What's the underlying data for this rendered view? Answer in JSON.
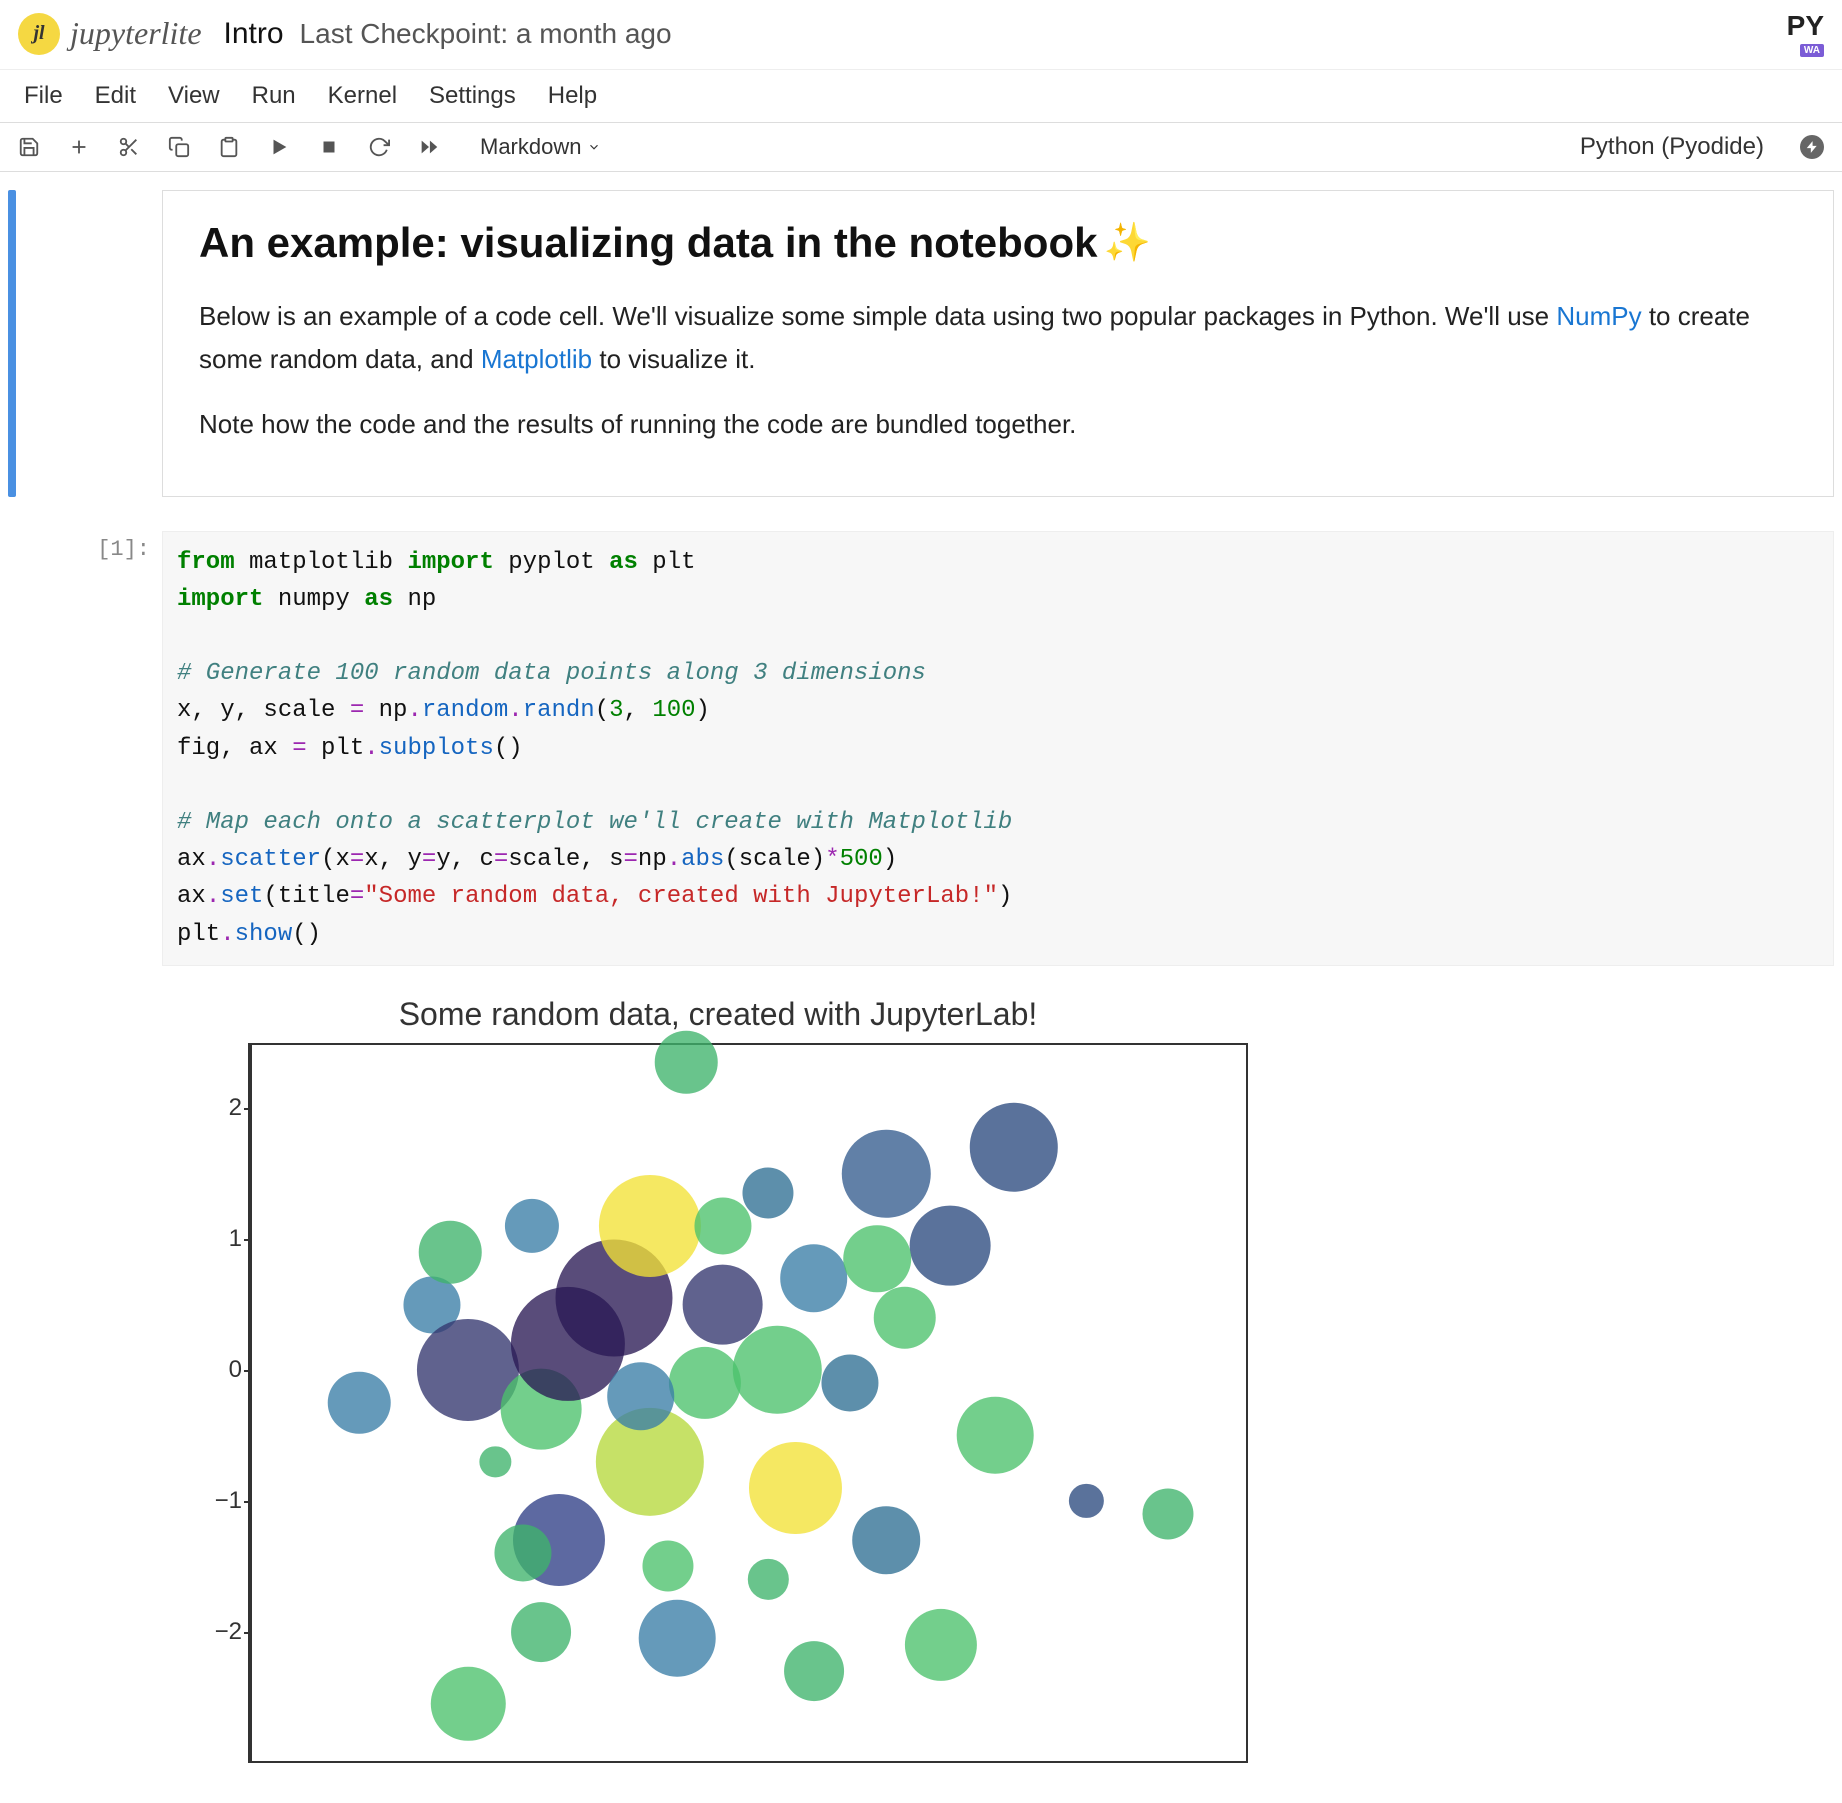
{
  "header": {
    "logo_initials": "jl",
    "logo_text": "jupyterlite",
    "doc_title": "Intro",
    "checkpoint": "Last Checkpoint: a month ago",
    "py_label": "PY",
    "wa_label": "WA"
  },
  "menubar": [
    "File",
    "Edit",
    "View",
    "Run",
    "Kernel",
    "Settings",
    "Help"
  ],
  "toolbar": {
    "celltype": "Markdown",
    "kernel": "Python (Pyodide)"
  },
  "md_cell": {
    "heading": "An example: visualizing data in the notebook",
    "sparkle": "✨",
    "para1_pre": "Below is an example of a code cell. We'll visualize some simple data using two popular packages in Python. We'll use ",
    "numpy": "NumPy",
    "para1_mid": " to create some random data, and ",
    "matplotlib": "Matplotlib",
    "para1_post": " to visualize it.",
    "para2": "Note how the code and the results of running the code are bundled together."
  },
  "code_cell": {
    "prompt": "[1]:",
    "l1_from": "from",
    "l1_mpl": " matplotlib ",
    "l1_import": "import",
    "l1_rest": " pyplot ",
    "l1_as": "as",
    "l1_plt": " plt",
    "l2_import": "import",
    "l2_np": " numpy ",
    "l2_as": "as",
    "l2_rest": " np",
    "l4_cmt": "# Generate 100 random data points along 3 dimensions",
    "l5_a": "x, y, scale ",
    "l5_eq": "=",
    "l5_b": " np",
    "l5_dot1": ".",
    "l5_rand": "random",
    "l5_dot2": ".",
    "l5_randn": "randn",
    "l5_p": "(",
    "l5_n1": "3",
    "l5_c": ", ",
    "l5_n2": "100",
    "l5_cp": ")",
    "l6_a": "fig, ax ",
    "l6_eq": "=",
    "l6_b": " plt",
    "l6_dot": ".",
    "l6_fn": "subplots",
    "l6_p": "()",
    "l8_cmt": "# Map each onto a scatterplot we'll create with Matplotlib",
    "l9_a": "ax",
    "l9_dot": ".",
    "l9_fn": "scatter",
    "l9_p1": "(x",
    "l9_eq1": "=",
    "l9_p2": "x, y",
    "l9_eq2": "=",
    "l9_p3": "y, c",
    "l9_eq3": "=",
    "l9_p4": "scale, s",
    "l9_eq4": "=",
    "l9_p5": "np",
    "l9_d2": ".",
    "l9_abs": "abs",
    "l9_p6": "(scale)",
    "l9_star": "*",
    "l9_n": "500",
    "l9_cp": ")",
    "l10_a": "ax",
    "l10_dot": ".",
    "l10_fn": "set",
    "l10_p": "(title",
    "l10_eq": "=",
    "l10_str": "\"Some random data, created with JupyterLab!\"",
    "l10_cp": ")",
    "l11_a": "plt",
    "l11_dot": ".",
    "l11_fn": "show",
    "l11_p": "()"
  },
  "chart_data": {
    "type": "scatter",
    "title": "Some random data, created with JupyterLab!",
    "xlabel": "",
    "ylabel": "",
    "xlim": [
      -2.5,
      3.0
    ],
    "ylim": [
      -3,
      2.5
    ],
    "yticks": [
      -2,
      -1,
      0,
      1,
      2
    ],
    "colormap": "viridis",
    "points": [
      {
        "x": -0.1,
        "y": 2.35,
        "scale": 0.6,
        "color": "#3fb36b"
      },
      {
        "x": 1.0,
        "y": 1.5,
        "scale": 1.2,
        "color": "#345c8e"
      },
      {
        "x": 1.7,
        "y": 1.7,
        "scale": 1.2,
        "color": "#2c4a7f"
      },
      {
        "x": -1.9,
        "y": -0.25,
        "scale": 0.6,
        "color": "#3a7da6"
      },
      {
        "x": -1.5,
        "y": 0.5,
        "scale": 0.5,
        "color": "#3a7da6"
      },
      {
        "x": -1.3,
        "y": 0.0,
        "scale": 1.6,
        "color": "#33366e"
      },
      {
        "x": -0.9,
        "y": -0.3,
        "scale": 1.0,
        "color": "#4cc16c"
      },
      {
        "x": -0.75,
        "y": 0.2,
        "scale": 2.0,
        "color": "#2a1a54"
      },
      {
        "x": -0.5,
        "y": 0.55,
        "scale": 2.1,
        "color": "#2a1a54"
      },
      {
        "x": -0.3,
        "y": 1.1,
        "scale": 1.6,
        "color": "#f2e236"
      },
      {
        "x": -0.3,
        "y": -0.7,
        "scale": 1.8,
        "color": "#b6d93c"
      },
      {
        "x": -0.8,
        "y": -1.3,
        "scale": 1.3,
        "color": "#2f3f86"
      },
      {
        "x": 0.0,
        "y": -0.1,
        "scale": 0.8,
        "color": "#4cc16c"
      },
      {
        "x": 0.1,
        "y": 0.5,
        "scale": 1.0,
        "color": "#33366e"
      },
      {
        "x": 0.35,
        "y": 1.35,
        "scale": 0.4,
        "color": "#2f6f93"
      },
      {
        "x": 0.4,
        "y": 0.0,
        "scale": 1.2,
        "color": "#4cc16c"
      },
      {
        "x": 0.5,
        "y": -0.9,
        "scale": 1.3,
        "color": "#f2e236"
      },
      {
        "x": 0.6,
        "y": 0.7,
        "scale": 0.7,
        "color": "#3a7da6"
      },
      {
        "x": 0.8,
        "y": -0.1,
        "scale": 0.5,
        "color": "#2f6f93"
      },
      {
        "x": 1.0,
        "y": -1.3,
        "scale": 0.7,
        "color": "#2f6f93"
      },
      {
        "x": 1.1,
        "y": 0.4,
        "scale": 0.6,
        "color": "#4cc16c"
      },
      {
        "x": 1.3,
        "y": -2.1,
        "scale": 0.8,
        "color": "#4cc16c"
      },
      {
        "x": 1.35,
        "y": 0.95,
        "scale": 1.0,
        "color": "#2c4a7f"
      },
      {
        "x": 1.6,
        "y": -0.5,
        "scale": 0.9,
        "color": "#4cc16c"
      },
      {
        "x": 2.1,
        "y": -1.0,
        "scale": 0.18,
        "color": "#2c4a7f"
      },
      {
        "x": 2.55,
        "y": -1.1,
        "scale": 0.4,
        "color": "#3fb36b"
      },
      {
        "x": -0.15,
        "y": -2.05,
        "scale": 0.9,
        "color": "#3a7da6"
      },
      {
        "x": 0.6,
        "y": -2.3,
        "scale": 0.55,
        "color": "#3fb36b"
      },
      {
        "x": -1.3,
        "y": -2.55,
        "scale": 0.85,
        "color": "#4cc16c"
      },
      {
        "x": -1.0,
        "y": -1.4,
        "scale": 0.5,
        "color": "#3fb36b"
      },
      {
        "x": -1.4,
        "y": 0.9,
        "scale": 0.6,
        "color": "#3fb36b"
      },
      {
        "x": -0.2,
        "y": -1.5,
        "scale": 0.4,
        "color": "#4cc16c"
      },
      {
        "x": -1.15,
        "y": -0.7,
        "scale": 0.15,
        "color": "#3fb36b"
      },
      {
        "x": 0.1,
        "y": 1.1,
        "scale": 0.5,
        "color": "#4cc16c"
      },
      {
        "x": 0.95,
        "y": 0.85,
        "scale": 0.7,
        "color": "#4cc16c"
      },
      {
        "x": -0.95,
        "y": 1.1,
        "scale": 0.45,
        "color": "#3a7da6"
      },
      {
        "x": -0.35,
        "y": -0.2,
        "scale": 0.7,
        "color": "#3a7da6"
      },
      {
        "x": -0.9,
        "y": -2.0,
        "scale": 0.55,
        "color": "#3fb36b"
      },
      {
        "x": 0.35,
        "y": -1.6,
        "scale": 0.25,
        "color": "#3fb36b"
      }
    ]
  }
}
